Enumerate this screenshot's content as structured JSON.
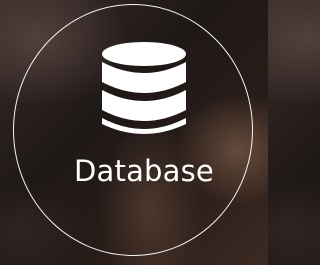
{
  "tile": {
    "label": "Database",
    "icon": "database-icon"
  }
}
